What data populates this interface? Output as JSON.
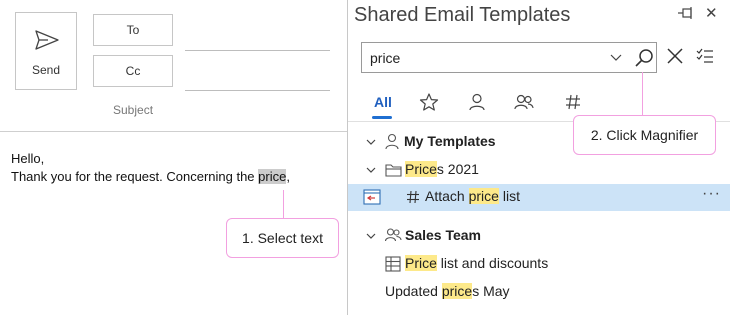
{
  "compose": {
    "send_label": "Send",
    "to_label": "To",
    "cc_label": "Cc",
    "subject_label": "Subject",
    "body_line1": "Hello,",
    "body_line2_prefix": "Thank you for the request. Concerning the ",
    "body_line2_selected": "price",
    "body_line2_suffix": ","
  },
  "callout1": {
    "text": "1. Select text"
  },
  "callout2": {
    "text": "2. Click Magnifier"
  },
  "pane": {
    "title": "Shared Email Templates",
    "search_value": "price",
    "tabs": [
      {
        "label": "All",
        "active": true
      },
      {
        "icon": "star-icon"
      },
      {
        "icon": "person-icon"
      },
      {
        "icon": "people-icon"
      },
      {
        "icon": "hashtag-icon"
      }
    ]
  },
  "tree": {
    "my_templates": "My Templates",
    "folder_prefix_hl": "Price",
    "folder_suffix": "s 2021",
    "macro_prefix": "Attach ",
    "macro_hl": "price",
    "macro_suffix": " list",
    "more": "···",
    "sales_team": "Sales Team",
    "item1_hl": "Price",
    "item1_suffix": " list and discounts",
    "item2_prefix": "Updated ",
    "item2_hl": "price",
    "item2_suffix": "s May"
  },
  "colors": {
    "highlight": "#fde98a",
    "selected_row": "#cce3f7",
    "callout_border": "#f2a0e0",
    "accent": "#1f6fd1"
  }
}
